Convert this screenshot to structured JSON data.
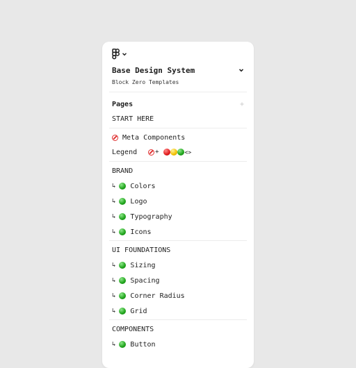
{
  "file": {
    "title": "Base Design System",
    "subtitle": "Block Zero Templates"
  },
  "pages": {
    "header": "Pages",
    "add_icon": "+",
    "arrow": "↳",
    "sections": [
      "START HERE",
      "BRAND",
      "UI FOUNDATIONS",
      "COMPONENTS"
    ],
    "meta": "Meta Components",
    "legend": {
      "label": "Legend",
      "plus": "+",
      "code": "<>"
    },
    "brand_items": [
      "Colors",
      "Logo",
      "Typography",
      "Icons"
    ],
    "foundation_items": [
      "Sizing",
      "Spacing",
      "Corner Radius",
      "Grid"
    ],
    "component_items": [
      "Button"
    ]
  },
  "colors": {
    "status_green": "#1fa31b",
    "status_red": "#e01b1b",
    "status_yellow": "#f2c100"
  }
}
